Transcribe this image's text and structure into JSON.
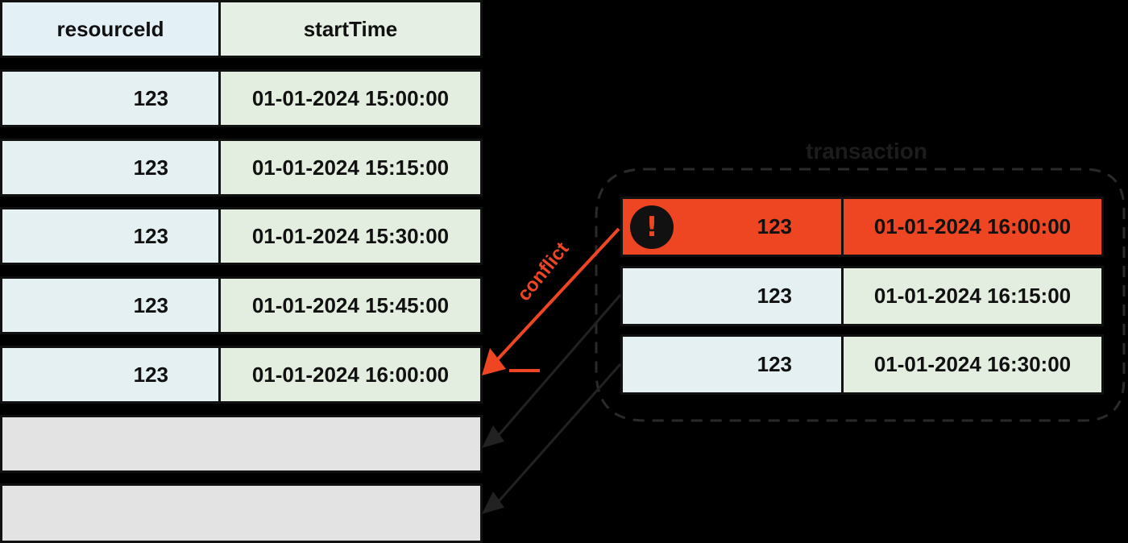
{
  "main_table": {
    "headers": {
      "resource_id": "resourceId",
      "start_time": "startTime"
    },
    "rows": [
      {
        "resource_id": "123",
        "start_time": "01-01-2024 15:00:00"
      },
      {
        "resource_id": "123",
        "start_time": "01-01-2024 15:15:00"
      },
      {
        "resource_id": "123",
        "start_time": "01-01-2024 15:30:00"
      },
      {
        "resource_id": "123",
        "start_time": "01-01-2024 15:45:00"
      },
      {
        "resource_id": "123",
        "start_time": "01-01-2024 16:00:00"
      }
    ],
    "empty_rows": 2
  },
  "transaction": {
    "label": "transaction",
    "rows": [
      {
        "resource_id": "123",
        "start_time": "01-01-2024 16:00:00",
        "status": "conflict"
      },
      {
        "resource_id": "123",
        "start_time": "01-01-2024 16:15:00",
        "status": "ok"
      },
      {
        "resource_id": "123",
        "start_time": "01-01-2024 16:30:00",
        "status": "ok"
      }
    ],
    "alert_icon": "exclamation-icon",
    "alert_glyph": "!"
  },
  "arrow_label": "conflict",
  "colors": {
    "background": "#000000",
    "conflict": "#ee4522",
    "id_cell": "#e4f0f1",
    "time_cell": "#e3ede0",
    "empty_cell": "#e3e3e3"
  }
}
